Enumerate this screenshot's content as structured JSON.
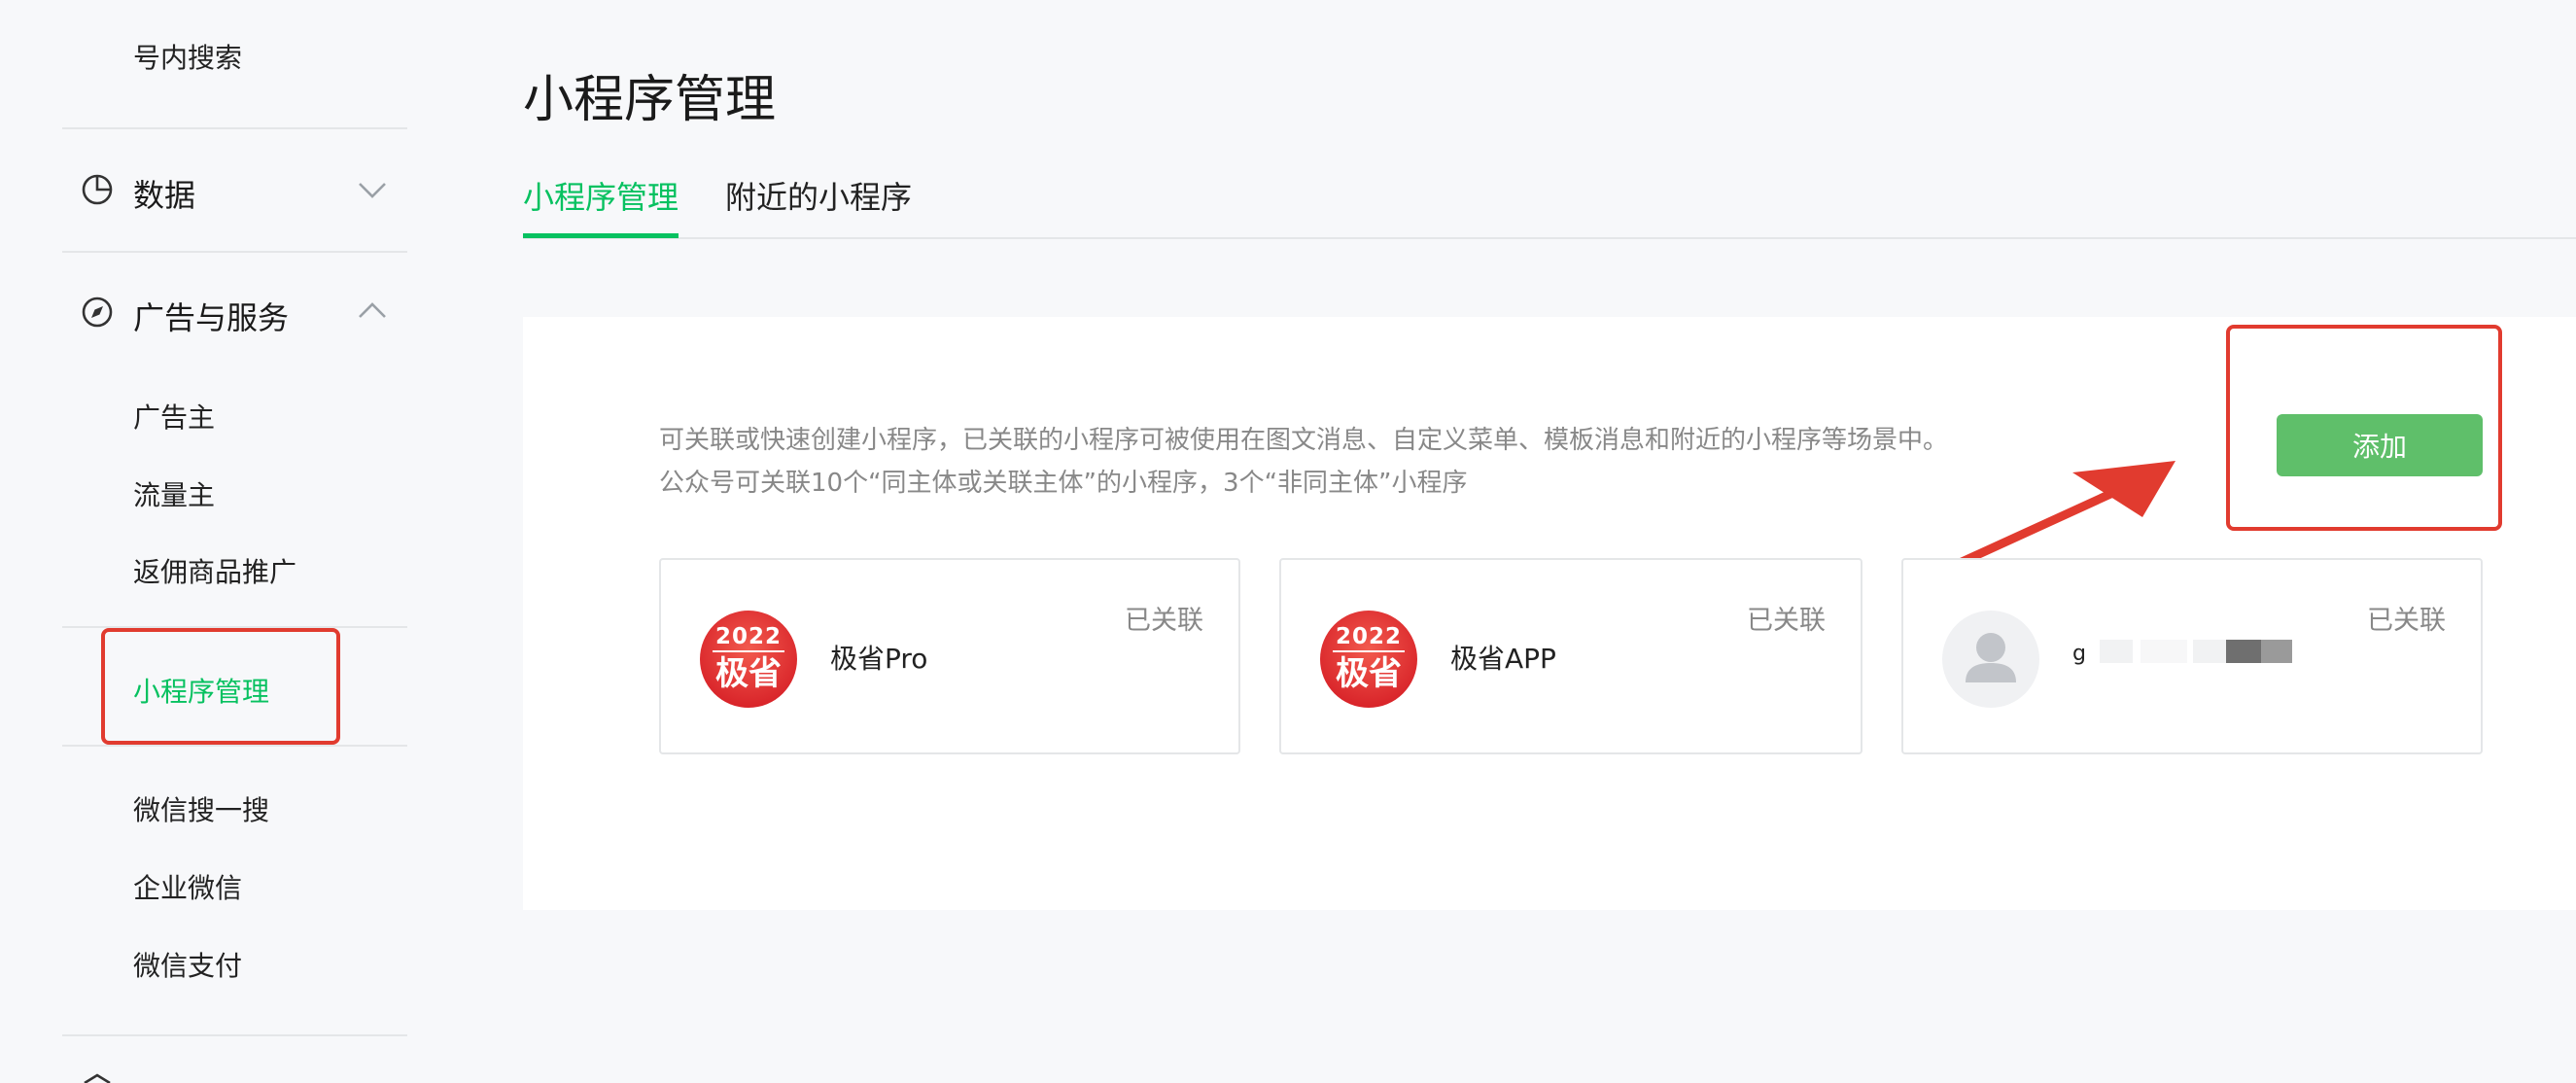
{
  "sidebar": {
    "top_item": "号内搜索",
    "groups": [
      {
        "label": "数据",
        "icon": "pie-chart-icon",
        "expanded": false
      },
      {
        "label": "广告与服务",
        "icon": "compass-icon",
        "expanded": true
      }
    ],
    "items": [
      "广告主",
      "流量主",
      "返佣商品推广",
      "小程序管理",
      "微信搜一搜",
      "企业微信",
      "微信支付"
    ],
    "active_item": "小程序管理"
  },
  "main": {
    "title": "小程序管理",
    "tabs": [
      {
        "label": "小程序管理",
        "active": true
      },
      {
        "label": "附近的小程序",
        "active": false
      }
    ],
    "description_line1": "可关联或快速创建小程序，已关联的小程序可被使用在图文消息、自定义菜单、模板消息和附近的小程序等场景中。",
    "description_line2": "公众号可关联10个“同主体或关联主体”的小程序，3个“非同主体”小程序",
    "add_button": "添加",
    "cards": [
      {
        "name": "极省Pro",
        "status": "已关联",
        "logo_year": "2022",
        "logo_text": "极省"
      },
      {
        "name": "极省APP",
        "status": "已关联",
        "logo_year": "2022",
        "logo_text": "极省"
      },
      {
        "name": "g",
        "status": "已关联"
      }
    ]
  },
  "colors": {
    "accent": "#07c160",
    "button": "#5fbf6a",
    "annotation": "#e13b2f",
    "logo_red": "#d9252a"
  }
}
